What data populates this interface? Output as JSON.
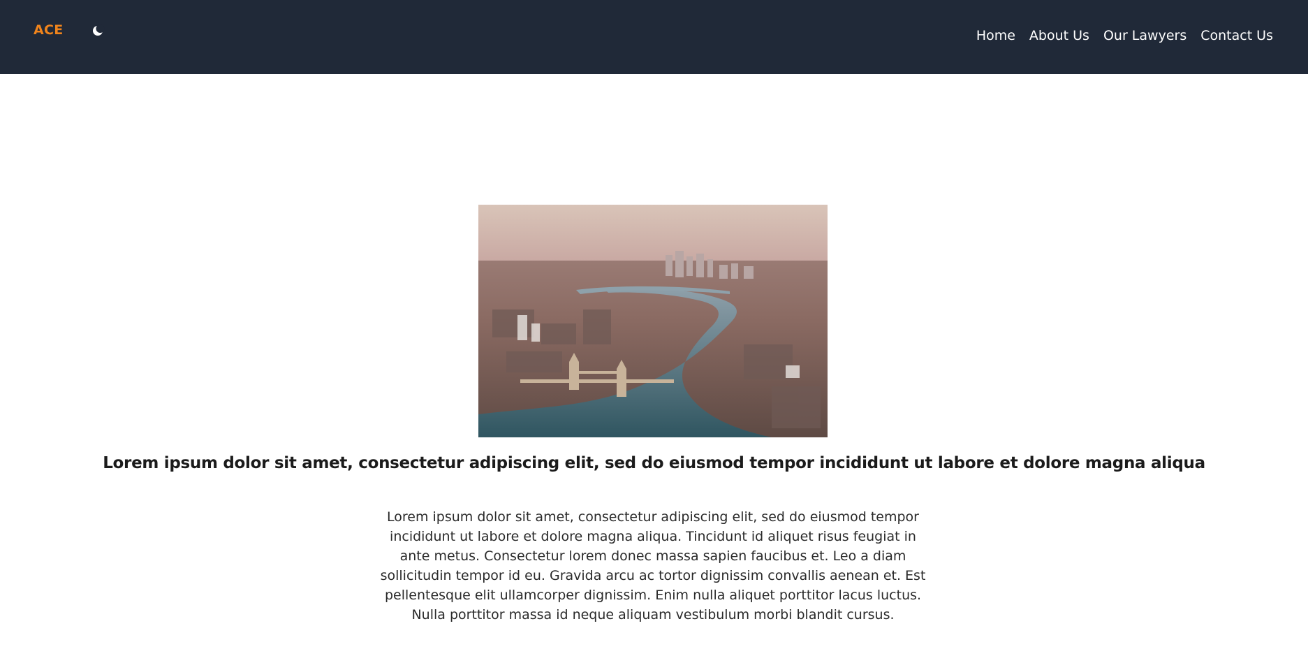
{
  "brand": {
    "logo_text": "ACE",
    "accent_color": "#f0841c",
    "navbar_color": "#202938"
  },
  "nav": {
    "theme_icon": "moon-icon",
    "links": [
      {
        "label": "Home"
      },
      {
        "label": "About Us"
      },
      {
        "label": "Our Lawyers"
      },
      {
        "label": "Contact Us"
      }
    ]
  },
  "main": {
    "image_subject": "aerial-city-river-bridge-photo",
    "headline": "Lorem ipsum dolor sit amet, consectetur adipiscing elit, sed do eiusmod tempor incididunt ut labore et dolore magna aliqua",
    "body": "Lorem ipsum dolor sit amet, consectetur adipiscing elit, sed do eiusmod tempor incididunt ut labore et dolore magna aliqua. Tincidunt id aliquet risus feugiat in ante metus. Consectetur lorem donec massa sapien faucibus et. Leo a diam sollicitudin tempor id eu. Gravida arcu ac tortor dignissim convallis aenean et. Est pellentesque elit ullamcorper dignissim. Enim nulla aliquet porttitor lacus luctus. Nulla porttitor massa id neque aliquam vestibulum morbi blandit cursus."
  }
}
